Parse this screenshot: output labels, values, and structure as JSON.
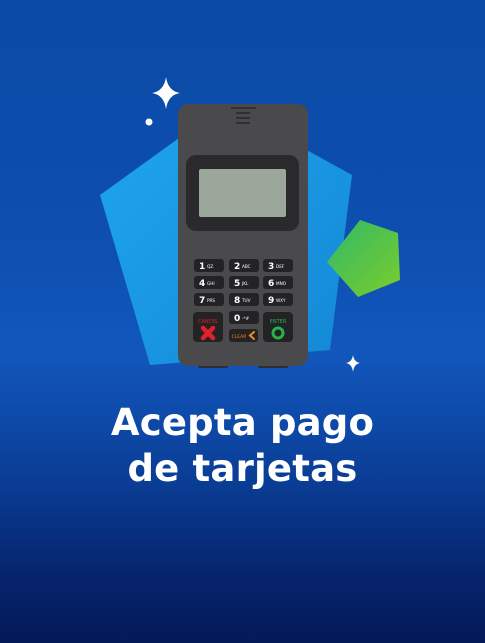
{
  "headline": {
    "line1": "Acepta pago",
    "line2": "de tarjetas"
  },
  "terminal": {
    "keys": [
      {
        "digit": "1",
        "sub": "QZ."
      },
      {
        "digit": "2",
        "sub": "ABC"
      },
      {
        "digit": "3",
        "sub": "DEF"
      },
      {
        "digit": "4",
        "sub": "GHI"
      },
      {
        "digit": "5",
        "sub": "JKL"
      },
      {
        "digit": "6",
        "sub": "MNO"
      },
      {
        "digit": "7",
        "sub": "PRS"
      },
      {
        "digit": "8",
        "sub": "TUV"
      },
      {
        "digit": "9",
        "sub": "WXY"
      },
      {
        "digit": "0",
        "sub": "-*#"
      }
    ],
    "cancel_label": "CANCEL",
    "clear_label": "CLEAR",
    "enter_label": "ENTER"
  },
  "colors": {
    "background_top": "#0d4eae",
    "background_bottom": "#041a57",
    "pentagon_blue": "#1aa0e8",
    "pentagon_green": "#5cc03a",
    "terminal_body": "#4a4a4c",
    "screen": "#9aa79a",
    "cancel_red": "#e0202a",
    "enter_green": "#27b24a",
    "clear_orange": "#f08a1a"
  },
  "icons": [
    "sparkle-icon",
    "cancel-x-icon",
    "enter-circle-icon",
    "clear-arrow-icon",
    "speaker-grille-icon"
  ]
}
